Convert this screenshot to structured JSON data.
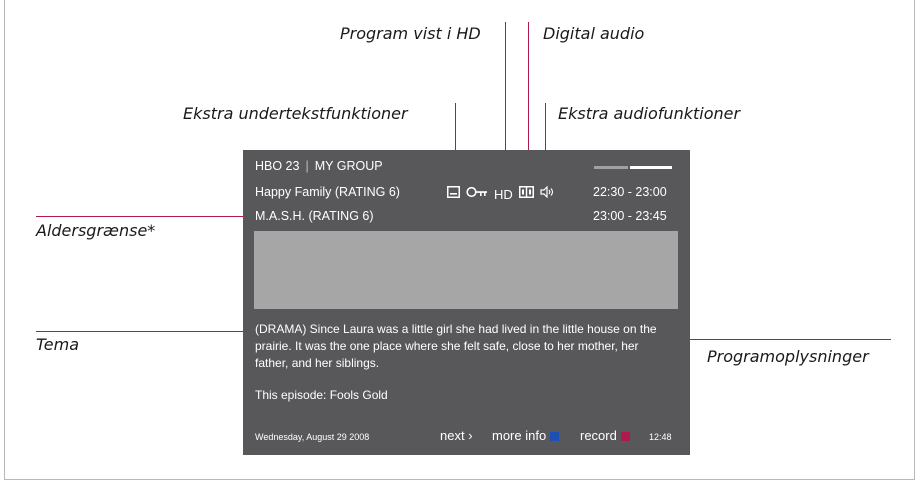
{
  "labels": {
    "program_hd": "Program vist i HD",
    "digital_audio": "Digital audio",
    "extra_subtitles": "Ekstra undertekstfunktioner",
    "extra_audio": "Ekstra audiofunktioner",
    "age_limit": "Aldersgrænse*",
    "theme": "Tema",
    "program_info": "Programoplysninger"
  },
  "panel": {
    "channel": "HBO 23",
    "group": "MY GROUP",
    "separator": "|",
    "current_program": "Happy Family (RATING 6)",
    "current_time": "22:30 - 23:00",
    "next_program": "M.A.S.H. (RATING 6)",
    "next_time": "23:00 - 23:45",
    "description": "(DRAMA) Since Laura was a little girl she had lived in the little house on the prairie. It was the one place where she felt safe, close to her mother, her father, and her siblings.",
    "episode": "This episode: Fools Gold",
    "date": "Wednesday, August 29 2008",
    "next_label": "next",
    "next_arrow": "›",
    "more_info_label": "more info",
    "record_label": "record",
    "clock": "12:48",
    "hd_label": "HD",
    "icons": [
      "subtitle-icon",
      "key-icon",
      "hd-icon",
      "dolby-icon",
      "audio-icon"
    ]
  },
  "colors": {
    "panel_bg": "#58585a",
    "media_area": "#a6a6a6",
    "callout_line": "#b0184f",
    "more_info_blue": "#1e4fb5",
    "record_red": "#b0184f",
    "signal_dim": "#a0a0a0",
    "signal_bright": "#ffffff"
  }
}
